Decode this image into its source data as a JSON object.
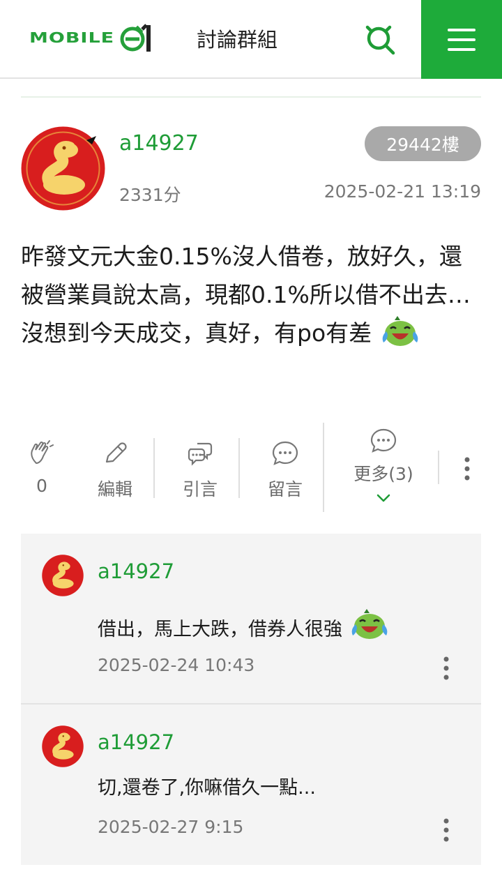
{
  "header": {
    "logo_text": "MOBILE",
    "logo_suffix": "01",
    "title": "討論群組",
    "search_icon": "search-icon",
    "menu_icon": "hamburger-menu-icon",
    "brand_color": "#1eab3a"
  },
  "post": {
    "author": "a14927",
    "score": "2331分",
    "floor": "29442樓",
    "timestamp": "2025-02-21 13:19",
    "body": "昨發文元大金0.15%沒人借卷，放好久，還被營業員說太高，現都0.1%所以借不出去…沒想到今天成交，真好，有po有差",
    "emoji": "laughing-crying-emoji"
  },
  "actions": {
    "clap_count": "0",
    "edit_label": "編輯",
    "quote_label": "引言",
    "comment_label": "留言",
    "more_label": "更多(3)"
  },
  "replies": [
    {
      "author": "a14927",
      "text": "借出，馬上大跌，借券人很強",
      "timestamp": "2025-02-24 10:43"
    },
    {
      "author": "a14927",
      "text": "切,還卷了,你嘛借久一點...",
      "timestamp": "2025-02-27 9:15"
    }
  ]
}
